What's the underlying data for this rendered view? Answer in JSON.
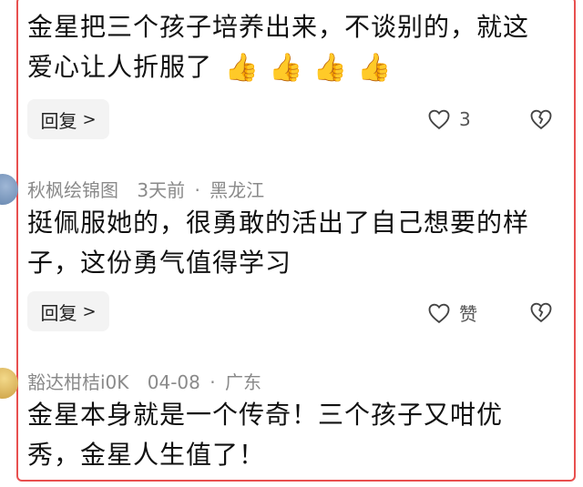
{
  "comments": [
    {
      "text_line1": "金星把三个孩子培养出来，不谈别的，就这",
      "text_line2": "爱心让人折服了",
      "emoji": [
        "👍",
        "👍",
        "👍",
        "👍"
      ],
      "reply_label": "回复",
      "like_count": "3"
    },
    {
      "author": "秋枫绘锦图",
      "time": "3天前",
      "separator": "·",
      "location": "黑龙江",
      "text_line1": "挺佩服她的，很勇敢的活出了自己想要的样",
      "text_line2": "子，这份勇气值得学习",
      "reply_label": "回复",
      "like_label": "赞"
    },
    {
      "author": "豁达柑桔i0K",
      "time": "04-08",
      "separator": "·",
      "location": "广东",
      "text_line1": "金星本身就是一个传奇！三个孩子又咁优",
      "text_line2": "秀，金星人生值了！"
    }
  ],
  "colors": {
    "frame": "#e8504f",
    "meta": "#8a8a8a",
    "reply_bg": "#f3f3f3"
  }
}
